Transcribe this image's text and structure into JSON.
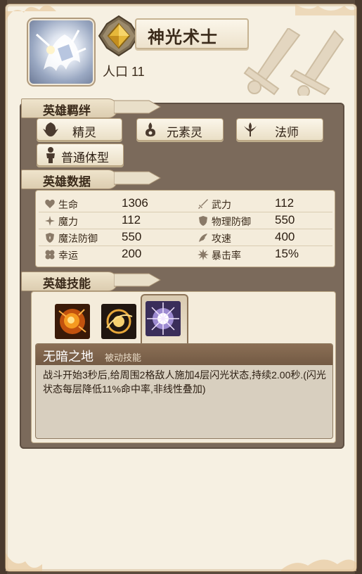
{
  "hero": {
    "name": "神光术士",
    "population": "人口 11"
  },
  "sections": {
    "bonds_title": "英雄羁绊",
    "stats_title": "英雄数据",
    "skills_title": "英雄技能"
  },
  "bonds": [
    {
      "label": "精灵",
      "icon": "elf-icon"
    },
    {
      "label": "元素灵",
      "icon": "element-spirit-icon"
    },
    {
      "label": "法师",
      "icon": "mage-icon"
    },
    {
      "label": "普通体型",
      "icon": "human-body-icon"
    }
  ],
  "stats": {
    "hp": {
      "label": "生命",
      "value": "1306"
    },
    "attack": {
      "label": "武力",
      "value": "112"
    },
    "magic": {
      "label": "魔力",
      "value": "112"
    },
    "phys_def": {
      "label": "物理防御",
      "value": "550"
    },
    "magic_def": {
      "label": "魔法防御",
      "value": "550"
    },
    "atk_speed": {
      "label": "攻速",
      "value": "400"
    },
    "luck": {
      "label": "幸运",
      "value": "200"
    },
    "crit": {
      "label": "暴击率",
      "value": "15%"
    }
  },
  "skills": {
    "icons": [
      "fire-fist-icon",
      "golden-orb-icon",
      "radiant-light-icon"
    ],
    "selected_index": 2,
    "selected": {
      "name": "无暗之地",
      "type": "被动技能",
      "description": "战斗开始3秒后,给周围2格敌人施加4层闪光状态,持续2.00秒.(闪光状态每层降低11%命中率,非线性叠加)"
    }
  },
  "colors": {
    "panel_bg": "#f6f0e2",
    "main_box": "#7b6a5b",
    "skill_header": "#7b6049"
  }
}
